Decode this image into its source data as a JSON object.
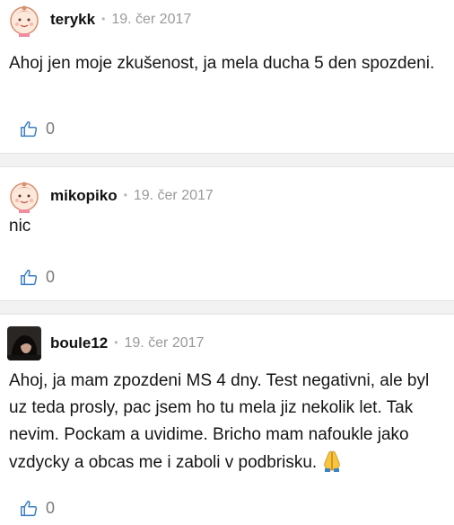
{
  "comments": [
    {
      "user": "terykk",
      "separator": "•",
      "date": "19. čer 2017",
      "text": "Ahoj jen moje zkušenost, ja mela ducha 5 den spozdeni.",
      "likes": "0",
      "avatar_icon": "baby-avatar-icon"
    },
    {
      "user": "mikopiko",
      "separator": "•",
      "date": "19. čer 2017",
      "text": "nic",
      "likes": "0",
      "avatar_icon": "baby-avatar-icon"
    },
    {
      "user": "boule12",
      "separator": "•",
      "date": "19. čer 2017",
      "text": "Ahoj, ja mam zpozdeni MS 4 dny. Test negativni, ale byl uz teda prosly, pac jsem ho tu mela jiz nekolik let. Tak nevim. Pockam a uvidime. Bricho mam nafoukle jako vzdycky a obcas me i zaboli v podbrisku.",
      "likes": "0",
      "avatar_icon": "photo-avatar",
      "emoji_icon": "folded-hands-icon"
    }
  ],
  "colors": {
    "background": "#ffffff",
    "separator_band": "#f2f2f2",
    "date": "#9a9a9a",
    "like_icon": "#3b7fc4",
    "like_count": "#7a7a7a"
  }
}
